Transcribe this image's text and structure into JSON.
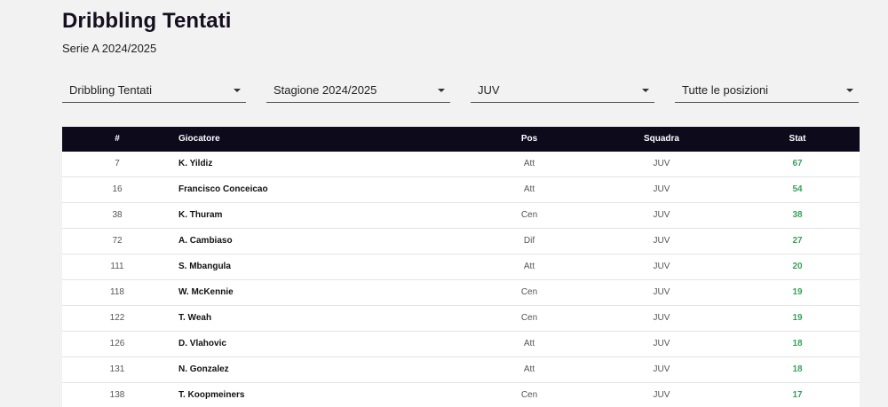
{
  "page": {
    "title": "Dribbling Tentati",
    "subtitle": "Serie A 2024/2025"
  },
  "filters": [
    {
      "selected": "Dribbling Tentati"
    },
    {
      "selected": "Stagione 2024/2025"
    },
    {
      "selected": "JUV"
    },
    {
      "selected": "Tutte le posizioni"
    }
  ],
  "table": {
    "headers": {
      "rank": "#",
      "player": "Giocatore",
      "pos": "Pos",
      "team": "Squadra",
      "stat": "Stat"
    },
    "rows": [
      {
        "rank": "7",
        "player": "K. Yildiz",
        "pos": "Att",
        "team": "JUV",
        "stat": "67"
      },
      {
        "rank": "16",
        "player": "Francisco Conceicao",
        "pos": "Att",
        "team": "JUV",
        "stat": "54"
      },
      {
        "rank": "38",
        "player": "K. Thuram",
        "pos": "Cen",
        "team": "JUV",
        "stat": "38"
      },
      {
        "rank": "72",
        "player": "A. Cambiaso",
        "pos": "Dif",
        "team": "JUV",
        "stat": "27"
      },
      {
        "rank": "111",
        "player": "S. Mbangula",
        "pos": "Att",
        "team": "JUV",
        "stat": "20"
      },
      {
        "rank": "118",
        "player": "W. McKennie",
        "pos": "Cen",
        "team": "JUV",
        "stat": "19"
      },
      {
        "rank": "122",
        "player": "T. Weah",
        "pos": "Cen",
        "team": "JUV",
        "stat": "19"
      },
      {
        "rank": "126",
        "player": "D. Vlahovic",
        "pos": "Att",
        "team": "JUV",
        "stat": "18"
      },
      {
        "rank": "131",
        "player": "N. Gonzalez",
        "pos": "Att",
        "team": "JUV",
        "stat": "18"
      },
      {
        "rank": "138",
        "player": "T. Koopmeiners",
        "pos": "Cen",
        "team": "JUV",
        "stat": "17"
      }
    ]
  },
  "colors": {
    "header_bg": "#0d0a1c",
    "stat_green": "#3aa35a",
    "page_bg": "#f2f2f2"
  }
}
